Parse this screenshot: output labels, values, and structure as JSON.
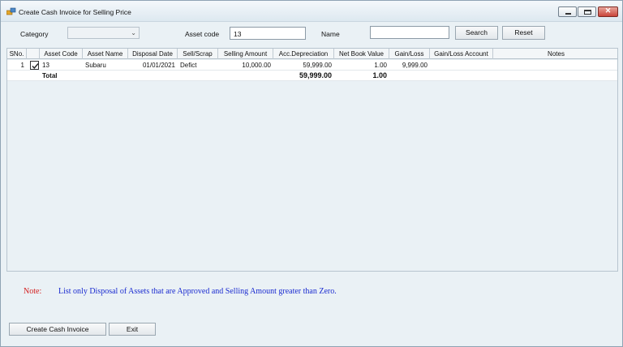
{
  "window": {
    "title": "Create Cash Invoice for Selling Price"
  },
  "filters": {
    "category_label": "Category",
    "category_value": "",
    "asset_code_label": "Asset code",
    "asset_code_value": "13",
    "name_label": "Name",
    "name_value": "",
    "search_label": "Search",
    "reset_label": "Reset"
  },
  "grid": {
    "columns": [
      "SNo.",
      "",
      "Asset Code",
      "Asset Name",
      "Disposal Date",
      "Sell/Scrap",
      "Selling Amount",
      "Acc.Depreciation",
      "Net Book Value",
      "Gain/Loss",
      "Gain/Loss Account",
      "Notes"
    ],
    "rows": [
      {
        "sno": "1",
        "checked": true,
        "asset_code": "13",
        "asset_name": "Subaru",
        "disposal_date": "01/01/2021",
        "sell_scrap": "Defict",
        "selling_amount": "10,000.00",
        "acc_depreciation": "59,999.00",
        "net_book_value": "1.00",
        "gain_loss": "9,999.00",
        "gain_loss_account": "",
        "notes": ""
      }
    ],
    "total": {
      "label": "Total",
      "acc_depreciation": "59,999.00",
      "net_book_value": "1.00"
    }
  },
  "note": {
    "label": "Note:",
    "text": "List only Disposal of Assets that are Approved and Selling Amount greater than Zero."
  },
  "actions": {
    "create_label": "Create Cash Invoice",
    "exit_label": "Exit"
  },
  "colors": {
    "note_label": "#d42020",
    "note_text": "#1a2bd0",
    "window_bg": "#eaf1f5"
  },
  "icons": {
    "app": "app-icon",
    "minimize": "minimize-icon",
    "maximize": "maximize-icon",
    "close": "close-icon",
    "dropdown": "chevron-down-icon",
    "checkbox": "checkmark-icon"
  }
}
